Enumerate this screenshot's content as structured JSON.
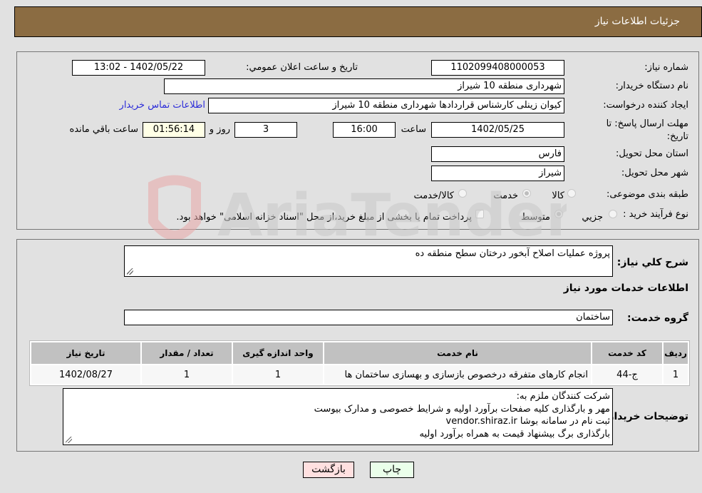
{
  "header": {
    "title": "جزئيات اطلاعات نياز"
  },
  "details": {
    "need_number_label": "شماره نياز:",
    "need_number": "1102099408000053",
    "announce_label": "تاريخ و ساعت اعلان عمومي:",
    "announce_value": "1402/05/22 - 13:02",
    "buyer_org_label": "نام دستگاه خريدار:",
    "buyer_org": "شهرداری منطقه 10 شیراز",
    "creator_label": "ايجاد کننده درخواست:",
    "creator": "کیوان زینلی کارشناس قراردادها شهرداری منطقه 10 شیراز",
    "buyer_contact_link": "اطلاعات تماس خريدار",
    "deadline_label": "مهلت ارسال پاسخ: تا تاريخ:",
    "deadline_date": "1402/05/25",
    "time_label": "ساعت",
    "deadline_time": "16:00",
    "days": "3",
    "days_label": "روز و",
    "remaining": "01:56:14",
    "remaining_label": "ساعت باقي مانده",
    "province_label": "استان محل تحويل:",
    "province": "فارس",
    "city_label": "شهر محل تحويل:",
    "city": "شیراز",
    "category_label": "طبقه بندی موضوعی:",
    "category_options": [
      {
        "label": "کالا",
        "checked": false
      },
      {
        "label": "خدمت",
        "checked": true
      },
      {
        "label": "کالا/خدمت",
        "checked": false
      }
    ],
    "process_label": "نوع فرآيند خريد :",
    "process_options": [
      {
        "label": "جزيي",
        "checked": false
      },
      {
        "label": "متوسط",
        "checked": true
      }
    ],
    "treasury_note": "پرداخت تمام یا بخشی از مبلغ خرید،از محل \"اسناد خزانه اسلامی\" خواهد بود."
  },
  "services": {
    "general_desc_label": "شرح کلي نياز:",
    "general_desc": "پروژه عملیات اصلاح آبخور درختان سطح منطقه ده",
    "section_title": "اطلاعات خدمات مورد نياز",
    "group_label": "گروه خدمت:",
    "group_value": "ساختمان",
    "table": {
      "headers": [
        "رديف",
        "کد خدمت",
        "نام خدمت",
        "واحد اندازه گيری",
        "تعداد / مقدار",
        "تاريخ نياز"
      ],
      "rows": [
        [
          "1",
          "ج-44",
          "انجام کارهای متفرقه درخصوص بازسازی و بهسازی ساختمان ها",
          "1",
          "1",
          "1402/08/27"
        ]
      ]
    },
    "buyer_notes_label": "توضيحات خريدار:",
    "buyer_notes": [
      "شرکت کنندگان ملزم به:",
      "مهر و بارگذاری کلیه صفحات برآورد اولیه و شرایط خصوصی و مدارک بیوست",
      "ثبت نام در سامانه بوشا vendor.shiraz.ir",
      "بارگذاری برگ بیشنهاد قیمت به همراه برآورد اولیه"
    ]
  },
  "buttons": {
    "print": "چاپ",
    "back": "بازگشت"
  },
  "colors": {
    "header_bg": "#8b6c42",
    "link": "#2b2bd9",
    "print_bg": "#eaffea",
    "back_bg": "#ffe0e0",
    "remaining_bg": "#ffffe6"
  },
  "watermark": {
    "text": "AriaTender.neT"
  }
}
